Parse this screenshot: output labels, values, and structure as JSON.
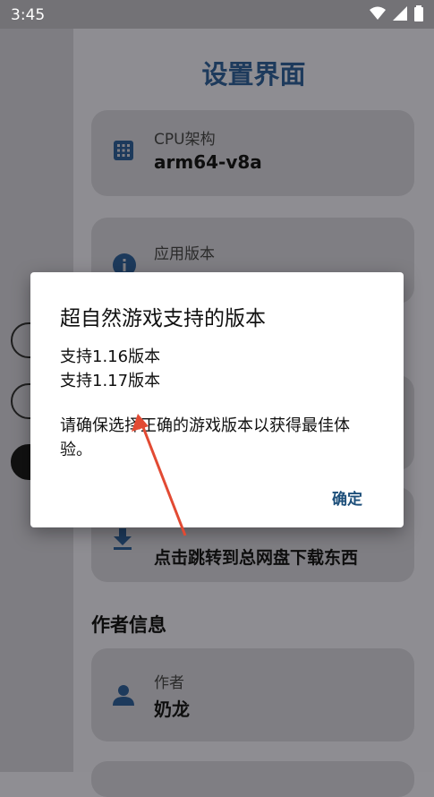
{
  "status_bar": {
    "time": "3:45"
  },
  "page": {
    "title": "设置界面"
  },
  "cards": {
    "cpu": {
      "label": "CPU架构",
      "value": "arm64-v8a"
    },
    "version": {
      "label": "应用版本"
    },
    "download": {
      "value": "点击跳转到总网盘下载东西"
    },
    "author": {
      "label": "作者",
      "value": "奶龙"
    }
  },
  "sections": {
    "author_info": "作者信息"
  },
  "dialog": {
    "title": "超自然游戏支持的版本",
    "line1": "支持1.16版本",
    "line2": "支持1.17版本",
    "body": "请确保选择正确的游戏版本以获得最佳体验。",
    "confirm": "确定"
  },
  "colors": {
    "accent": "#1d3a5c",
    "arrow": "#e24a33"
  }
}
